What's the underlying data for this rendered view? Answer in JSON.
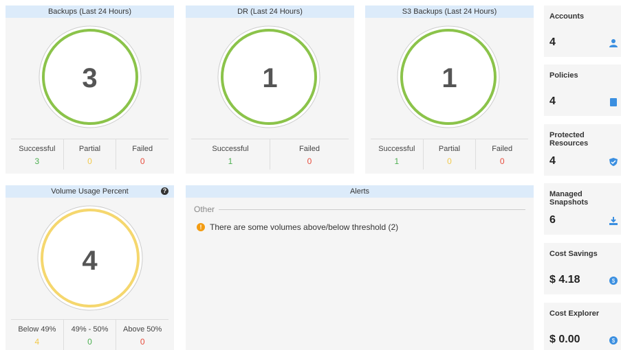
{
  "backups": {
    "title": "Backups (Last 24 Hours)",
    "total": "3",
    "stats": [
      {
        "label": "Successful",
        "value": "3"
      },
      {
        "label": "Partial",
        "value": "0"
      },
      {
        "label": "Failed",
        "value": "0"
      }
    ]
  },
  "dr": {
    "title": "DR (Last 24 Hours)",
    "total": "1",
    "stats": [
      {
        "label": "Successful",
        "value": "1"
      },
      {
        "label": "Failed",
        "value": "0"
      }
    ]
  },
  "s3": {
    "title": "S3 Backups (Last 24 Hours)",
    "total": "1",
    "stats": [
      {
        "label": "Successful",
        "value": "1"
      },
      {
        "label": "Partial",
        "value": "0"
      },
      {
        "label": "Failed",
        "value": "0"
      }
    ]
  },
  "volume": {
    "title": "Volume Usage Percent",
    "help_icon": "question-circle-icon",
    "total": "4",
    "stats": [
      {
        "label": "Below 49%",
        "value": "4"
      },
      {
        "label": "49% - 50%",
        "value": "0"
      },
      {
        "label": "Above 50%",
        "value": "0"
      }
    ]
  },
  "alerts": {
    "title": "Alerts",
    "group": "Other",
    "items": [
      {
        "icon": "warning-icon",
        "text": "There are some volumes above/below threshold (2)"
      }
    ]
  },
  "side": [
    {
      "title": "Accounts",
      "value": "4",
      "icon": "user-icon"
    },
    {
      "title": "Policies",
      "value": "4",
      "icon": "document-icon"
    },
    {
      "title": "Protected Resources",
      "value": "4",
      "icon": "shield-icon"
    },
    {
      "title": "Managed Snapshots",
      "value": "6",
      "icon": "download-icon"
    },
    {
      "title": "Cost Savings",
      "value": "$ 4.18",
      "icon": "coin-icon"
    },
    {
      "title": "Cost Explorer",
      "value": "$ 0.00",
      "icon": "coin-icon"
    }
  ],
  "colors": {
    "header_bg": "#dcebfa",
    "panel_bg": "#f5f5f5",
    "success": "#4caf50",
    "partial": "#f2c94c",
    "failed": "#e74c3c",
    "icon_blue": "#3b8fe0"
  }
}
